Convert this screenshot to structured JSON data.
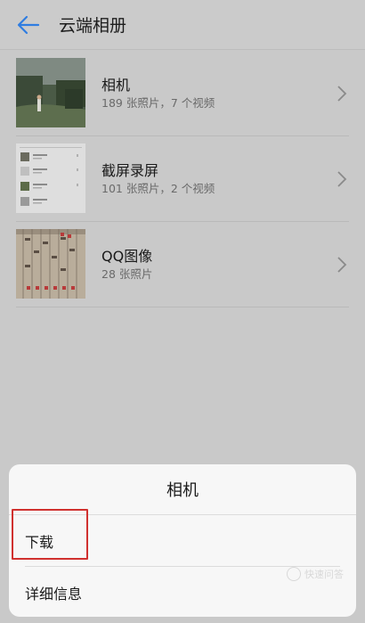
{
  "header": {
    "title": "云端相册",
    "back_icon": "arrow-left-icon",
    "accent": "#2f7de1"
  },
  "albums": [
    {
      "name": "相机",
      "count": "189 张照片，7 个视频",
      "thumbnail": "forest-photo"
    },
    {
      "name": "截屏录屏",
      "count": "101 张照片，2 个视频",
      "thumbnail": "screenshot-list"
    },
    {
      "name": "QQ图像",
      "count": "28 张照片",
      "thumbnail": "chart-photo"
    }
  ],
  "sheet": {
    "title": "相机",
    "items": [
      "下载",
      "详细信息"
    ]
  },
  "watermark": "快速问答"
}
